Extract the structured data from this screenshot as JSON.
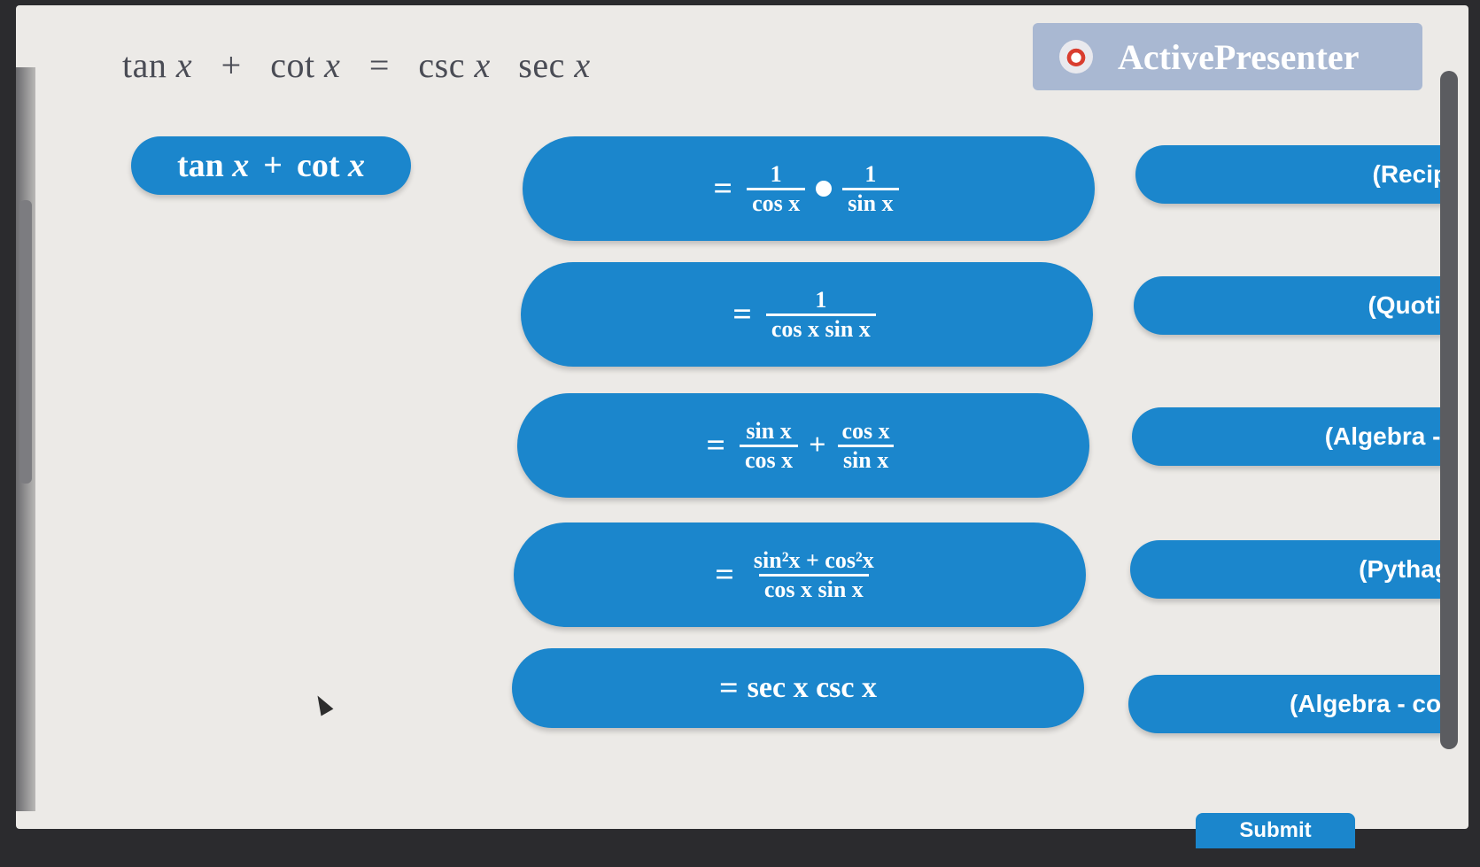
{
  "top_equation": {
    "lhs_a": "tan",
    "lhs_a_var": "x",
    "op_plus": "+",
    "lhs_b": "cot",
    "lhs_b_var": "x",
    "op_eq": "=",
    "rhs_a": "csc",
    "rhs_a_var": "x",
    "rhs_b": "sec",
    "rhs_b_var": "x"
  },
  "brand": {
    "name": "ActivePresenter"
  },
  "source": {
    "a": "tan",
    "var": "x",
    "plus": "+",
    "b": "cot",
    "var2": "x"
  },
  "steps": [
    {
      "eq": "=",
      "n1": "1",
      "d1": "cos x",
      "n2": "1",
      "d2": "sin x"
    },
    {
      "eq": "=",
      "n1": "1",
      "d1": "cos x  sin x"
    },
    {
      "eq": "=",
      "n1": "sin x",
      "d1": "cos x",
      "plus": "+",
      "n2": "cos x",
      "d2": "sin x"
    },
    {
      "eq": "=",
      "n1": "sin²x + cos²x",
      "d1": "cos x  sin x"
    },
    {
      "eq": "=",
      "text": "sec x  csc x"
    }
  ],
  "reasons": [
    "(Reciprocal",
    "(Quotient ic",
    "(Algebra - sepa",
    "(Pythagorea",
    "(Algebra - commo"
  ],
  "submit_label": "Submit",
  "colors": {
    "accent": "#1b86cc",
    "brand_bg": "#a9b8d2"
  }
}
